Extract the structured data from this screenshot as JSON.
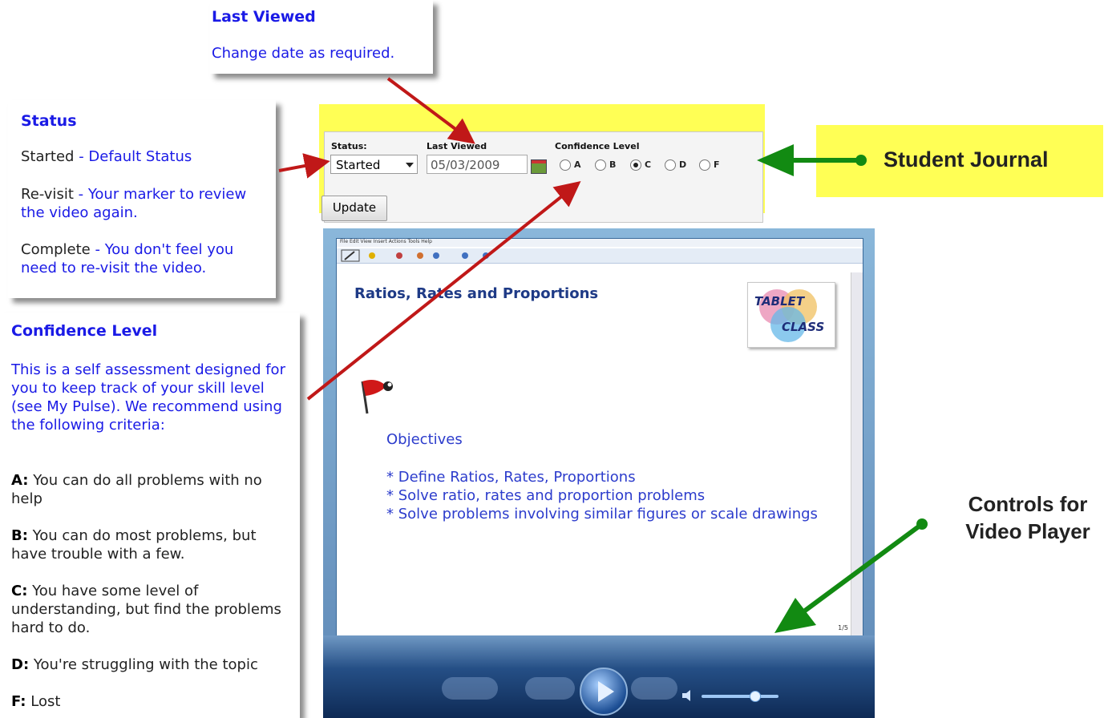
{
  "callouts": {
    "last_viewed": {
      "title": "Last Viewed",
      "text": "Change date as required."
    },
    "status": {
      "title": "Status",
      "lines": [
        {
          "term": "Started",
          "desc": " - Default Status"
        },
        {
          "term": "Re-visit",
          "desc": " - Your marker to review the video again."
        },
        {
          "term": "Complete",
          "desc": " - You don't feel you need to re-visit the video."
        }
      ]
    },
    "confidence": {
      "title": "Confidence Level",
      "intro": "This is a self assessment designed for you to keep track of your skill level (see My Pulse). We recommend using the following criteria:",
      "items": [
        {
          "grade": "A:",
          "text": " You can do all problems with no help"
        },
        {
          "grade": "B:",
          "text": " You can do most problems, but have trouble with a few."
        },
        {
          "grade": "C:",
          "text": " You have some level of understanding, but find the problems hard to do."
        },
        {
          "grade": "D:",
          "text": " You're struggling with the topic"
        },
        {
          "grade": "F:",
          "text": " Lost"
        }
      ]
    }
  },
  "journal": {
    "status_label": "Status:",
    "status_value": "Started",
    "last_viewed_label": "Last Viewed",
    "last_viewed_value": "05/03/2009",
    "confidence_label": "Confidence Level",
    "options": [
      "A",
      "B",
      "C",
      "D",
      "F"
    ],
    "selected_option": "C",
    "update_button": "Update"
  },
  "labels": {
    "student_journal": "Student Journal",
    "controls_for_video_player": "Controls for Video Player"
  },
  "slide": {
    "menu": "File  Edit  View  Insert  Actions  Tools  Help",
    "title": "Ratios, Rates and Proportions",
    "logo_text": "TABLET CLASS .com",
    "objectives_heading": "Objectives",
    "bullets": [
      "* Define Ratios, Rates, Proportions",
      "* Solve ratio, rates and proportion problems",
      "* Solve problems involving similar figures or scale drawings"
    ],
    "page_counter": "1/5"
  },
  "colors": {
    "highlight": "#ffff55",
    "callout_blue": "#1a1ae6",
    "red_arrow": "#c01818",
    "green_arrow": "#128a12"
  }
}
